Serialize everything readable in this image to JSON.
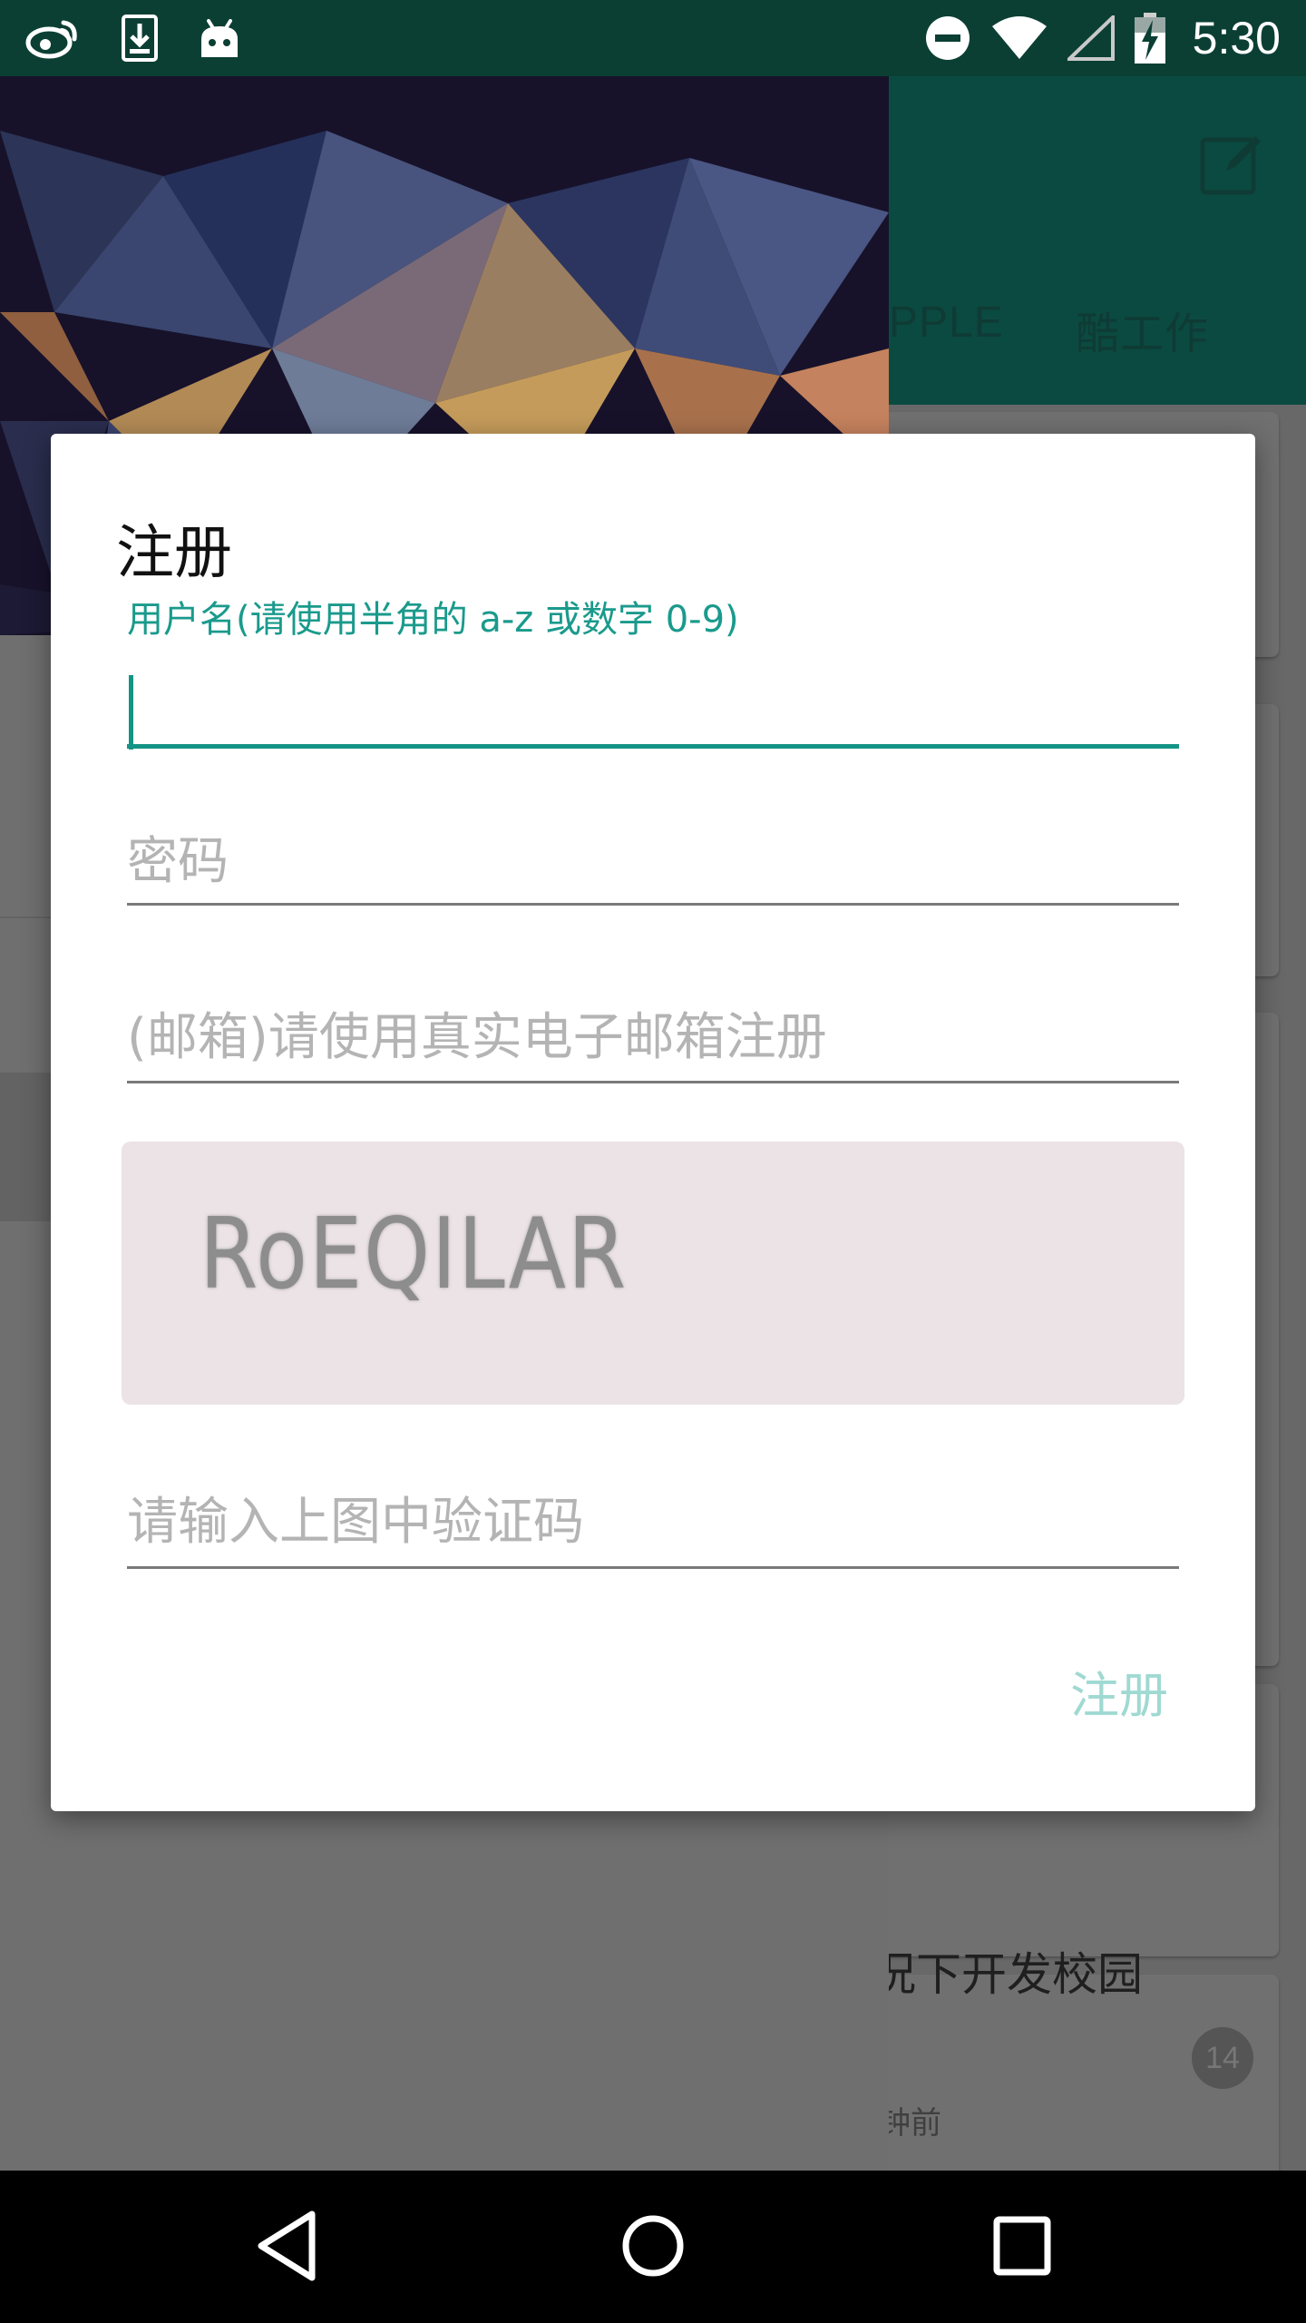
{
  "status_bar": {
    "time": "5:30",
    "left_icons": [
      "weibo-icon",
      "download-icon",
      "android-icon"
    ],
    "right_icons": [
      "do-not-disturb-icon",
      "wifi-icon",
      "cell-signal-icon",
      "battery-charging-icon"
    ],
    "background_color": "#0b3f34"
  },
  "background_app": {
    "tabs": [
      "PPLE",
      "酷工作"
    ],
    "card": {
      "title": "况下开发校园",
      "count": "14",
      "time": "钟前"
    },
    "toolbar_color": "#0b4a40"
  },
  "dialog": {
    "title": "注册",
    "username": {
      "label": "用户名(请使用半角的 a-z 或数字 0-9)",
      "value": ""
    },
    "password": {
      "placeholder": "密码"
    },
    "email": {
      "placeholder": "(邮箱)请使用真实电子邮箱注册"
    },
    "captcha": {
      "image_text": "RoEQILAR"
    },
    "captcha_input": {
      "placeholder": "请输入上图中验证码"
    },
    "register_label": "注册",
    "accent_color": "#149485"
  },
  "nav_bar": {
    "icons": [
      "back-icon",
      "home-icon",
      "recents-icon"
    ]
  }
}
